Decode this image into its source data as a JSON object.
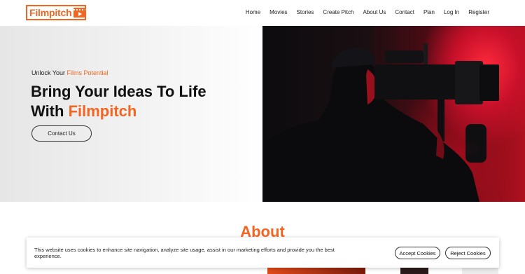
{
  "brand": {
    "name": "Filmpitch",
    "accent": "#f26522"
  },
  "nav": {
    "items": [
      "Home",
      "Movies",
      "Stories",
      "Create Pitch",
      "About Us",
      "Contact",
      "Plan",
      "Log In",
      "Register"
    ]
  },
  "hero": {
    "tagline_prefix": "Unlock Your ",
    "tagline_accent": "Films Potential",
    "headline_line1": "Bring Your Ideas To Life",
    "headline_line2_prefix": "With ",
    "headline_line2_accent": "Filmpitch",
    "cta_label": "Contact Us"
  },
  "about": {
    "title": "About"
  },
  "cookie_banner": {
    "text": "This website uses cookies to enhance site navigation, analyze site usage, assist in our marketing efforts and provide you the best experience.",
    "accept_label": "Accept Cookies",
    "reject_label": "Reject Cookies"
  }
}
